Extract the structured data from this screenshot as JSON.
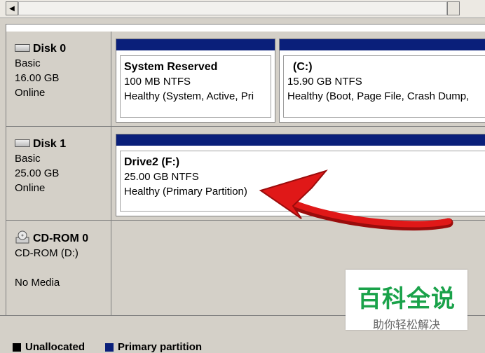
{
  "disks": [
    {
      "title": "Disk 0",
      "type": "Basic",
      "size": "16.00 GB",
      "status": "Online",
      "partitions": [
        {
          "name": "System Reserved",
          "size_fs": "100 MB NTFS",
          "health": "Healthy (System, Active, Pri"
        },
        {
          "name": "(C:)",
          "size_fs": "15.90 GB NTFS",
          "health": "Healthy (Boot, Page File, Crash Dump, "
        }
      ]
    },
    {
      "title": "Disk 1",
      "type": "Basic",
      "size": "25.00 GB",
      "status": "Online",
      "partitions": [
        {
          "name": "Drive2  (F:)",
          "size_fs": "25.00 GB NTFS",
          "health": "Healthy (Primary Partition)"
        }
      ]
    }
  ],
  "cdrom": {
    "title": "CD-ROM 0",
    "type": "CD-ROM (D:)",
    "media": "No Media"
  },
  "legend": {
    "unallocated": "Unallocated",
    "primary": "Primary partition"
  },
  "watermark": {
    "title": "百科全说",
    "subtitle": "助你轻松解决"
  },
  "colors": {
    "partition_bar": "#0a1f7a",
    "arrow": "#e01818",
    "watermark_green": "#1aa24a"
  }
}
